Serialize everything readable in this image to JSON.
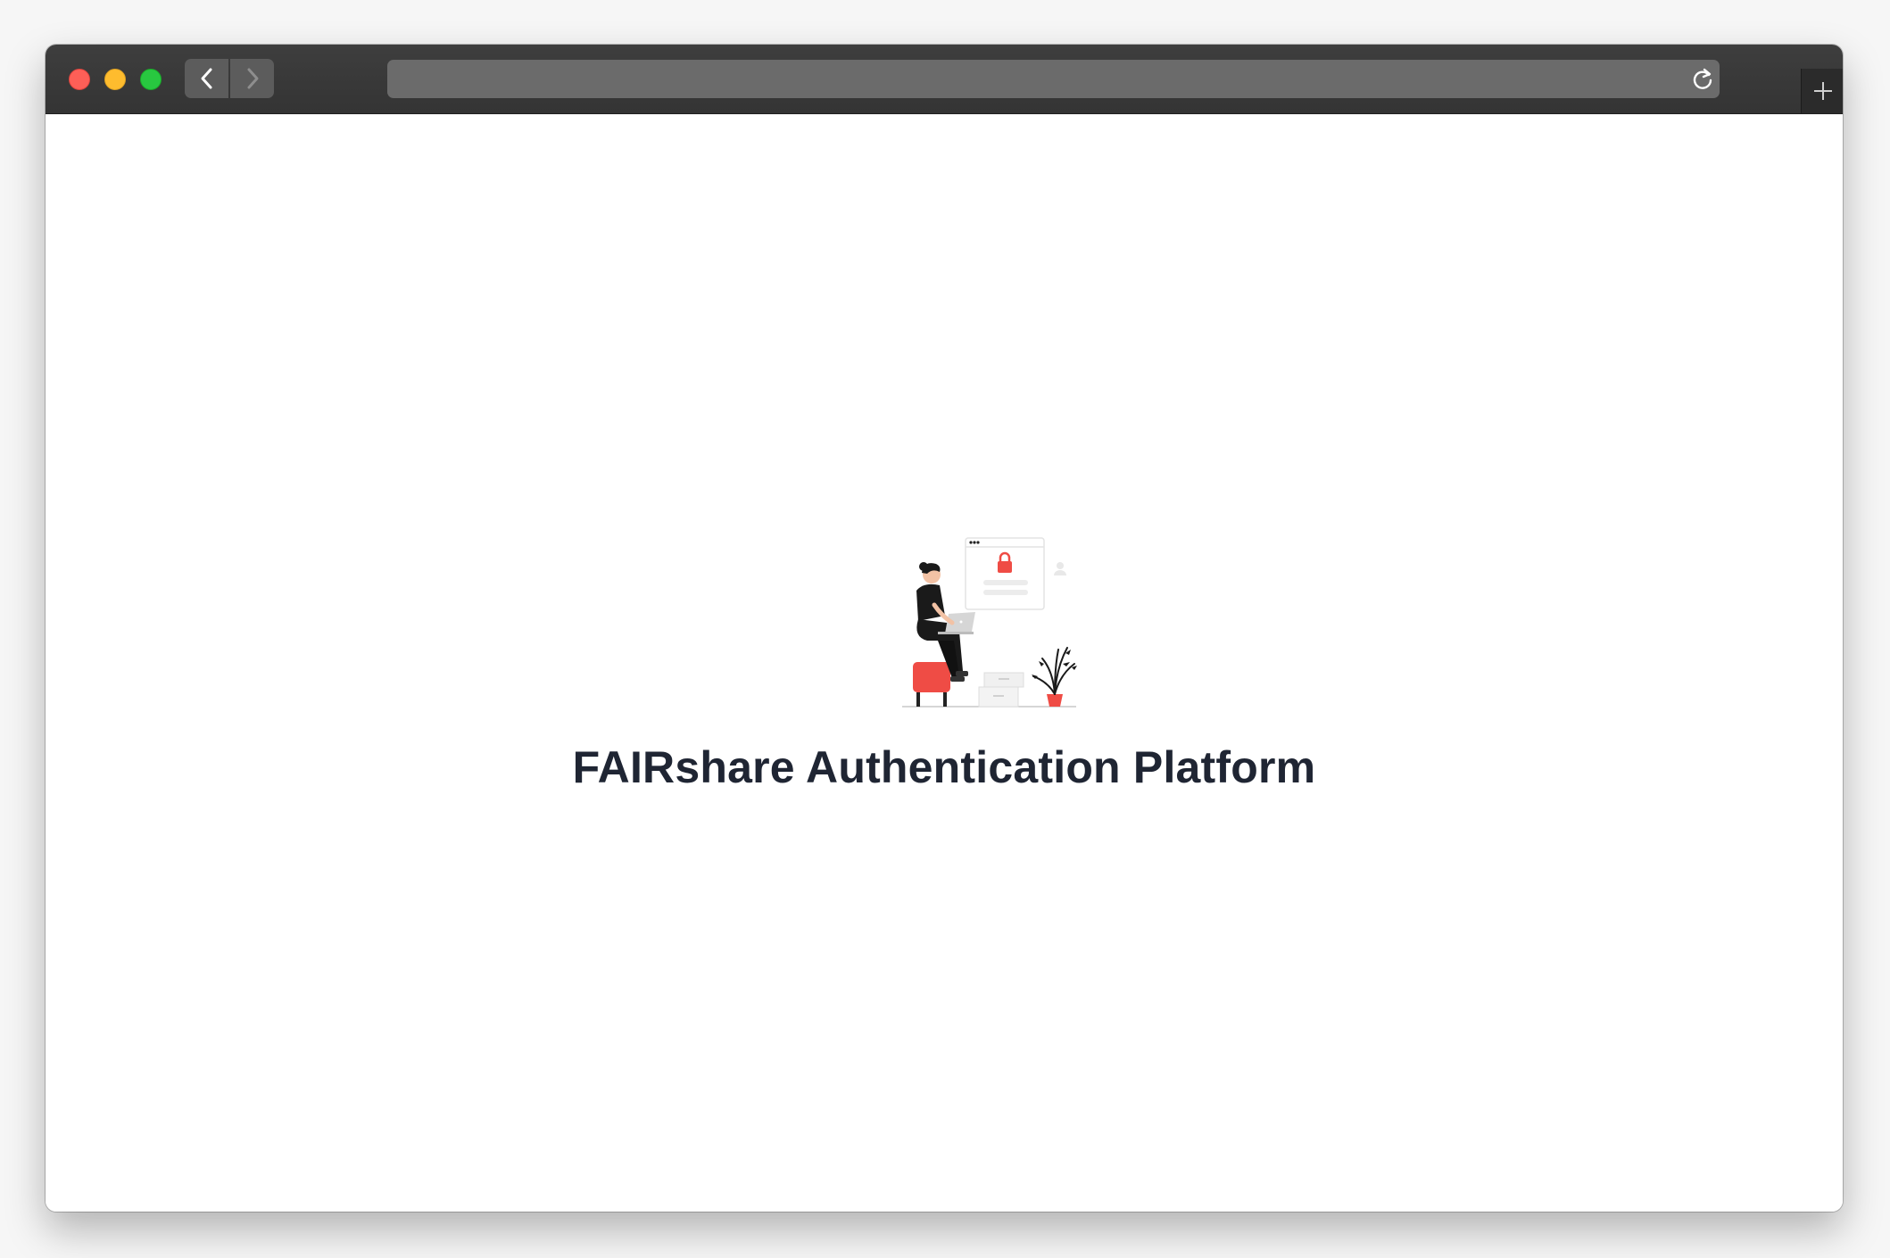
{
  "window": {
    "controls": [
      "close",
      "minimize",
      "maximize"
    ],
    "nav": {
      "back_icon": "chevron-left-icon",
      "forward_icon": "chevron-right-icon"
    },
    "address_bar": {
      "value": "",
      "reload_icon": "reload-icon"
    },
    "new_tab_icon": "plus-icon"
  },
  "page": {
    "title": "FAIRshare Authentication Platform",
    "illustration": "person-with-laptop-login-lock-illustration"
  },
  "colors": {
    "title": "#1f2533",
    "accent": "#ef4c45",
    "titlebar": "#3a3a3a"
  }
}
